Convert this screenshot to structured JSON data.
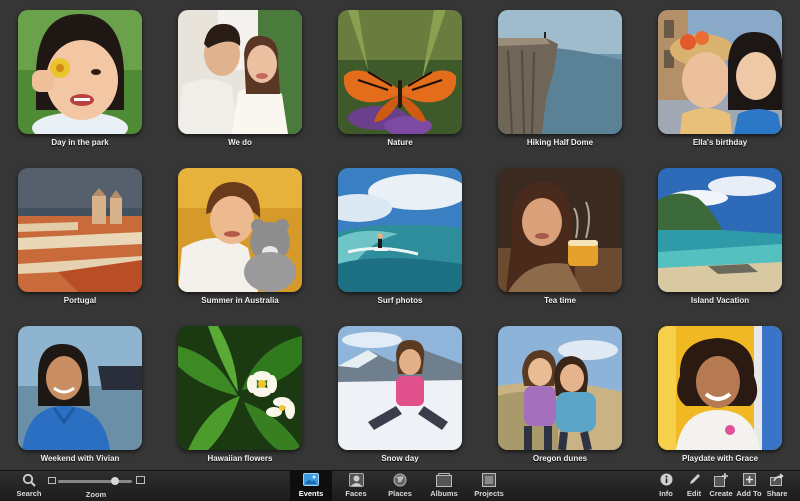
{
  "events": [
    {
      "label": "Day in the park"
    },
    {
      "label": "We do"
    },
    {
      "label": "Nature"
    },
    {
      "label": "Hiking Half Dome"
    },
    {
      "label": "Ella's birthday"
    },
    {
      "label": "Portugal"
    },
    {
      "label": "Summer in Australia"
    },
    {
      "label": "Surf photos"
    },
    {
      "label": "Tea time"
    },
    {
      "label": "Island Vacation"
    },
    {
      "label": "Weekend with Vivian"
    },
    {
      "label": "Hawaiian flowers"
    },
    {
      "label": "Snow day"
    },
    {
      "label": "Oregon dunes"
    },
    {
      "label": "Playdate with Grace"
    }
  ],
  "toolbar": {
    "search": "Search",
    "zoom": "Zoom",
    "zoom_level": 0.8,
    "events": "Events",
    "faces": "Faces",
    "places": "Places",
    "albums": "Albums",
    "projects": "Projects",
    "info": "Info",
    "edit": "Edit",
    "create": "Create",
    "add_to": "Add To",
    "share": "Share"
  },
  "colors": {
    "background": "#363636",
    "toolbar": "#1e1e1e",
    "caption": "#f2f2f2"
  }
}
